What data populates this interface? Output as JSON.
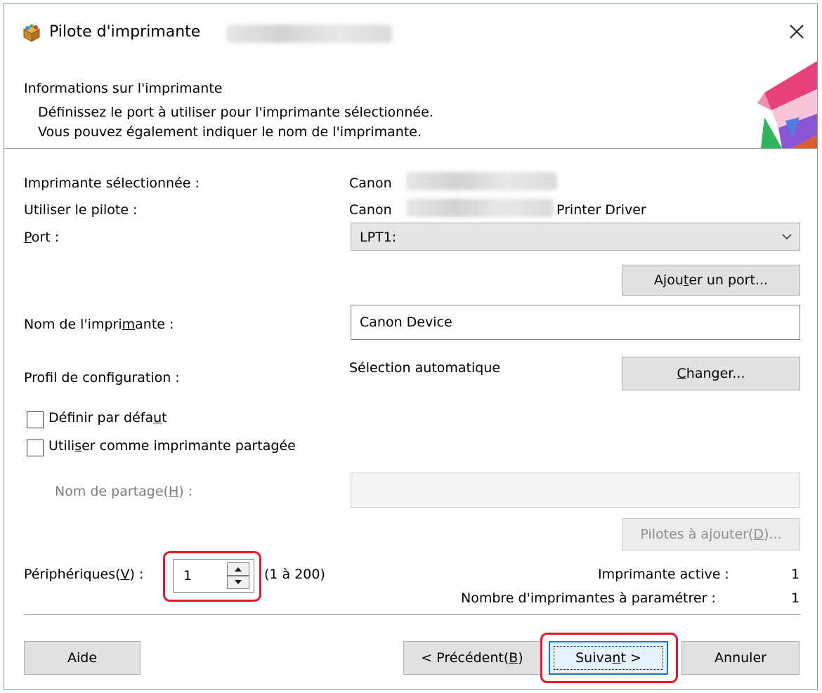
{
  "window": {
    "title": "Pilote d'imprimante",
    "close_icon": "close-icon"
  },
  "header": {
    "title": "Informations sur l'imprimante",
    "line1": "Définissez le port à utiliser pour l'imprimante sélectionnée.",
    "line2": "Vous pouvez également indiquer le nom de l'imprimante."
  },
  "info": {
    "selected_label": "Imprimante sélectionnée :",
    "selected_value": "Canon",
    "driver_label": "Utiliser le pilote :",
    "driver_value_prefix": "Canon",
    "driver_value_suffix": "Printer Driver"
  },
  "port": {
    "label_u": "P",
    "label_rest": "ort :",
    "value": "LPT1:",
    "add_port_pre": "Ajou",
    "add_port_u": "t",
    "add_port_post": "er un port..."
  },
  "printer_name": {
    "label_pre": "Nom de l'impri",
    "label_u": "m",
    "label_post": "ante :",
    "value": "Canon Device"
  },
  "config": {
    "label": "Profil de configuration :",
    "value": "Sélection automatique",
    "change_u": "C",
    "change_rest": "hanger..."
  },
  "options": {
    "default_pre": "Définir par défa",
    "default_u": "u",
    "default_post": "t",
    "default_checked": false,
    "shared_pre": "Utili",
    "shared_u": "s",
    "shared_post": "er comme imprimante partagée",
    "shared_checked": false
  },
  "share": {
    "label_pre": "Nom de partage(",
    "label_u": "H",
    "label_post": ") :",
    "value": "",
    "drivers_pre": "Pilotes à ajouter(",
    "drivers_u": "D",
    "drivers_post": ")..."
  },
  "devices": {
    "label_pre": "Périphériques(",
    "label_u": "V",
    "label_post": ") :",
    "value": "1",
    "range": "(1 à 200)"
  },
  "status": {
    "active_label": "Imprimante active :",
    "active_value": "1",
    "count_label": "Nombre d'imprimantes à paramétrer :",
    "count_value": "1"
  },
  "footer": {
    "help": "Aide",
    "back_pre": "< Précédent(",
    "back_u": "B",
    "back_post": ")",
    "next_pre": "Suiva",
    "next_u": "n",
    "next_post": "t >",
    "cancel": "Annuler"
  },
  "colors": {
    "highlight": "#e2192b",
    "focus_blue": "#0078d7"
  }
}
